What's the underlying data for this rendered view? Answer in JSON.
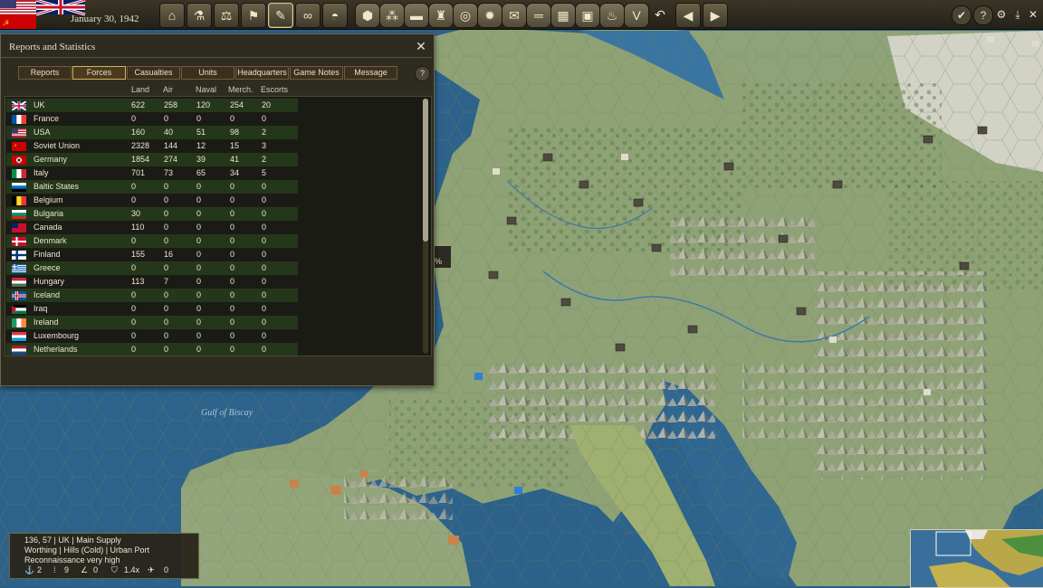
{
  "top": {
    "date": "January 30, 1942",
    "toolbar_icons": [
      "production-icon",
      "research-icon",
      "diplomacy-icon",
      "objectives-icon",
      "reports-icon",
      "intel-icon",
      "helmet-icon",
      "hex-build-icon",
      "hex-group-icon",
      "hex-tank-icon",
      "hex-fort-icon",
      "hex-target-icon",
      "hex-supply-icon",
      "hex-mail-icon",
      "hex-lines-icon",
      "hex-grid-icon",
      "hex-frame-icon",
      "hex-fire-icon",
      "victory-icon",
      "undo-icon",
      "prev-arrow-icon",
      "next-arrow-icon"
    ],
    "right_icons": [
      "end-turn-check-icon",
      "help-icon",
      "settings-icon",
      "save-download-icon",
      "close-x-icon"
    ]
  },
  "panel": {
    "title": "Reports and Statistics",
    "tabs": [
      "Reports",
      "Forces",
      "Casualties",
      "Units",
      "Headquarters",
      "Game Notes",
      "Message"
    ],
    "active_tab": "Forces",
    "columns": [
      "Land",
      "Air",
      "Naval",
      "Merch.",
      "Escorts"
    ],
    "rows": [
      {
        "country": "UK",
        "land": "622",
        "air": "258",
        "naval": "120",
        "merch": "254",
        "escorts": "20",
        "flag": "uk"
      },
      {
        "country": "France",
        "land": "0",
        "air": "0",
        "naval": "0",
        "merch": "0",
        "escorts": "0",
        "flag": "france"
      },
      {
        "country": "USA",
        "land": "160",
        "air": "40",
        "naval": "51",
        "merch": "98",
        "escorts": "2",
        "flag": "usa"
      },
      {
        "country": "Soviet Union",
        "land": "2328",
        "air": "144",
        "naval": "12",
        "merch": "15",
        "escorts": "3",
        "flag": "soviet"
      },
      {
        "country": "Germany",
        "land": "1854",
        "air": "274",
        "naval": "39",
        "merch": "41",
        "escorts": "2",
        "flag": "germany"
      },
      {
        "country": "Italy",
        "land": "701",
        "air": "73",
        "naval": "65",
        "merch": "34",
        "escorts": "5",
        "flag": "italy"
      },
      {
        "country": "Baltic States",
        "land": "0",
        "air": "0",
        "naval": "0",
        "merch": "0",
        "escorts": "0",
        "flag": "baltic"
      },
      {
        "country": "Belgium",
        "land": "0",
        "air": "0",
        "naval": "0",
        "merch": "0",
        "escorts": "0",
        "flag": "belgium"
      },
      {
        "country": "Bulgaria",
        "land": "30",
        "air": "0",
        "naval": "0",
        "merch": "0",
        "escorts": "0",
        "flag": "bulgaria"
      },
      {
        "country": "Canada",
        "land": "110",
        "air": "0",
        "naval": "0",
        "merch": "0",
        "escorts": "0",
        "flag": "canada"
      },
      {
        "country": "Denmark",
        "land": "0",
        "air": "0",
        "naval": "0",
        "merch": "0",
        "escorts": "0",
        "flag": "denmark"
      },
      {
        "country": "Finland",
        "land": "155",
        "air": "16",
        "naval": "0",
        "merch": "0",
        "escorts": "0",
        "flag": "finland"
      },
      {
        "country": "Greece",
        "land": "0",
        "air": "0",
        "naval": "0",
        "merch": "0",
        "escorts": "0",
        "flag": "greece"
      },
      {
        "country": "Hungary",
        "land": "113",
        "air": "7",
        "naval": "0",
        "merch": "0",
        "escorts": "0",
        "flag": "hungary"
      },
      {
        "country": "Iceland",
        "land": "0",
        "air": "0",
        "naval": "0",
        "merch": "0",
        "escorts": "0",
        "flag": "iceland"
      },
      {
        "country": "Iraq",
        "land": "0",
        "air": "0",
        "naval": "0",
        "merch": "0",
        "escorts": "0",
        "flag": "iraq"
      },
      {
        "country": "Ireland",
        "land": "0",
        "air": "0",
        "naval": "0",
        "merch": "0",
        "escorts": "0",
        "flag": "ireland"
      },
      {
        "country": "Luxembourg",
        "land": "0",
        "air": "0",
        "naval": "0",
        "merch": "0",
        "escorts": "0",
        "flag": "luxembourg"
      },
      {
        "country": "Netherlands",
        "land": "0",
        "air": "0",
        "naval": "0",
        "merch": "0",
        "escorts": "0",
        "flag": "netherlands"
      }
    ]
  },
  "map": {
    "label_sea": "Gulf of Biscay",
    "partial_label": "%"
  },
  "info": {
    "line1": "136, 57 | UK | Main Supply",
    "line2": "Worthing | Hills (Cold) | Urban Port",
    "line3": "Reconnaissance very high",
    "stats": [
      {
        "icon": "anchor-icon",
        "value": "2"
      },
      {
        "icon": "ammo-icon",
        "value": "9"
      },
      {
        "icon": "rail-icon",
        "value": "0"
      },
      {
        "icon": "shield-icon",
        "value": "1.4x"
      },
      {
        "icon": "aircraft-icon",
        "value": "0"
      }
    ]
  },
  "colors": {
    "sea": "#2a5f86",
    "shallow": "#4f8ab0",
    "land": "#8fa27a",
    "forest": "#6e8c57",
    "mountain": "#a9a696",
    "snow": "#e8e6e0"
  }
}
